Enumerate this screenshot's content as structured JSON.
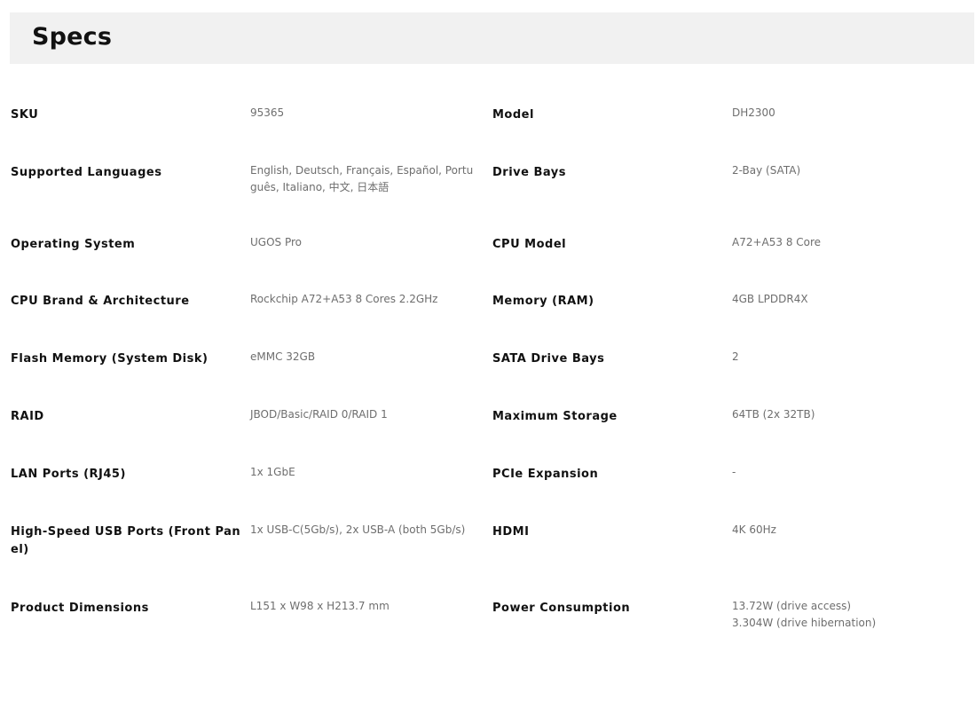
{
  "header": {
    "title": "Specs"
  },
  "specs": [
    {
      "left_label": "SKU",
      "left_value": "95365",
      "right_label": "Model",
      "right_value": "DH2300"
    },
    {
      "left_label": "Supported Languages",
      "left_value": "English, Deutsch, Français, Español, Português, Italiano, 中文, 日本語",
      "right_label": "Drive Bays",
      "right_value": "2-Bay (SATA)"
    },
    {
      "left_label": "Operating System",
      "left_value": "UGOS Pro",
      "right_label": "CPU Model",
      "right_value": "A72+A53 8 Core"
    },
    {
      "left_label": "CPU Brand & Architecture",
      "left_value": "Rockchip A72+A53 8 Cores 2.2GHz",
      "right_label": "Memory (RAM)",
      "right_value": "4GB LPDDR4X"
    },
    {
      "left_label": "Flash Memory (System Disk)",
      "left_value": "eMMC 32GB",
      "right_label": "SATA Drive Bays",
      "right_value": "2"
    },
    {
      "left_label": "RAID",
      "left_value": "JBOD/Basic/RAID 0/RAID 1",
      "right_label": "Maximum Storage",
      "right_value": "64TB (2x 32TB)"
    },
    {
      "left_label": "LAN Ports (RJ45)",
      "left_value": "1x 1GbE",
      "right_label": "PCIe Expansion",
      "right_value": "-"
    },
    {
      "left_label": "High-Speed USB Ports (Front Panel)",
      "left_value": "1x USB-C(5Gb/s), 2x USB-A (both 5Gb/s)",
      "right_label": "HDMI",
      "right_value": "4K 60Hz"
    },
    {
      "left_label": "Product Dimensions",
      "left_value": "L151 x W98 x H213.7 mm",
      "right_label": "Power Consumption",
      "right_value": "13.72W (drive access)\n3.304W (drive hibernation)"
    }
  ]
}
